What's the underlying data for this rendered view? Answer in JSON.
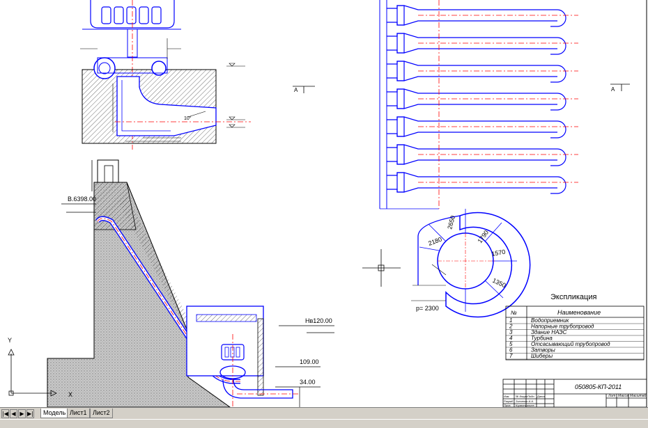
{
  "elevations": {
    "crest": "В.6398.00",
    "tailwater_high": "Нв120.00",
    "level_109": "109.00",
    "level_34": "34.00"
  },
  "section_marks": {
    "left": "A",
    "right": "A"
  },
  "dims": {
    "angle": "10°",
    "spiral_1": "2650",
    "spiral_2": "1790",
    "spiral_3": "2180",
    "spiral_4": "1570",
    "spiral_5": "1350",
    "spiral_radius": "р= 2300"
  },
  "explication": {
    "title": "Экспликация",
    "col_num": "№",
    "col_name": "Наименование",
    "rows": [
      {
        "num": "1",
        "name": "Водоприемник"
      },
      {
        "num": "2",
        "name": "Напорные трубопровод"
      },
      {
        "num": "3",
        "name": "Здание НАЭС"
      },
      {
        "num": "4",
        "name": "Турбина"
      },
      {
        "num": "5",
        "name": "Отсасывающий трубопровод"
      },
      {
        "num": "6",
        "name": "Затворы"
      },
      {
        "num": "7",
        "name": "Шиберы"
      }
    ]
  },
  "title_block": {
    "code": "050805-КП-2011",
    "sheet": "Лит",
    "mass": "Масса",
    "scale": "Масштаб",
    "row_labels": [
      "Изм.",
      "Разраб.",
      "Пров.",
      "Утв."
    ],
    "col_labels": [
      "№ докум.",
      "Подп.",
      "Дата"
    ],
    "names": [
      "Зинченко А.А.",
      "Курмангалиев"
    ]
  },
  "ucs": {
    "y_label": "Y",
    "x_label": "X"
  },
  "tabs": {
    "nav_first": "|◀",
    "nav_prev": "◀",
    "nav_next": "▶",
    "nav_last": "▶|",
    "items": [
      "Модель",
      "Лист1",
      "Лист2"
    ]
  },
  "colors": {
    "line_blue": "#0000ff",
    "axis_red": "#ff0000",
    "hatch": "#333333",
    "concrete": "#c8c8c8",
    "ui_gray": "#d4d0c8"
  }
}
